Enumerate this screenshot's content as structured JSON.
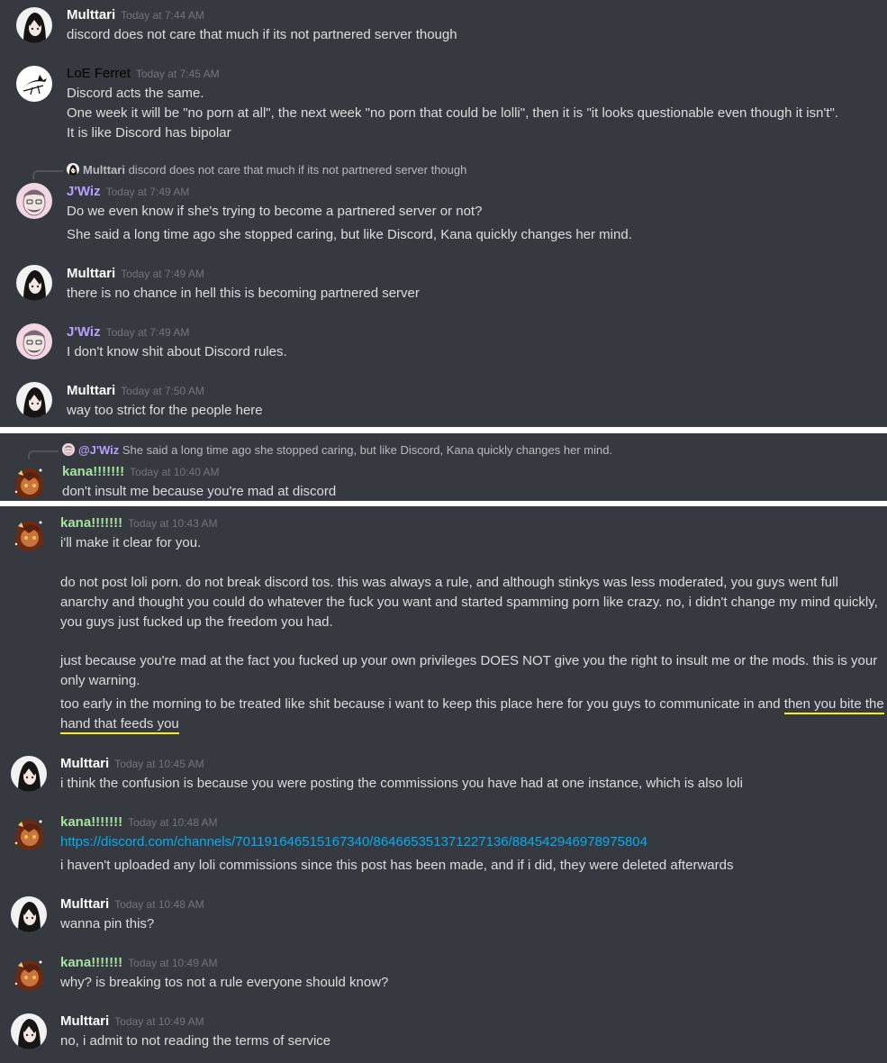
{
  "colors": {
    "background": "#36393f",
    "text": "#dcddde",
    "timestamp": "#72767d",
    "link": "#00aff4",
    "highlight": "#ffee00",
    "multtari": "#ffffff",
    "loe_ferret": "#000000",
    "jwiz": "#b9a0ff",
    "kana": "#a6e3a1"
  },
  "panel1": {
    "messages": [
      {
        "author": "Multtari",
        "timestamp": "Today at 7:44 AM",
        "avatar": "multtari-avatar",
        "lines": [
          "discord does not care that much if its not partnered server though"
        ]
      },
      {
        "author": "LoE Ferret",
        "timestamp": "Today at 7:45 AM",
        "avatar": "ferret-avatar",
        "lines": [
          "Discord acts the same.",
          "One week it will be \"no porn at all\", the next week  \"no porn that could be lolli\", then it is \"it looks questionable even though it isn't\".",
          "It is like Discord has bipolar"
        ]
      },
      {
        "reply": {
          "author": "Multtari",
          "text": "discord does not care that much if its not partnered server though"
        },
        "author": "J'Wiz",
        "timestamp": "Today at 7:49 AM",
        "avatar": "jwiz-avatar",
        "lines": [
          "Do we even know if she's trying to become a partnered server or not?",
          "She said a long time ago she stopped caring, but like Discord, Kana quickly changes her mind."
        ]
      },
      {
        "author": "Multtari",
        "timestamp": "Today at 7:49 AM",
        "avatar": "multtari-avatar",
        "lines": [
          "there is no chance in hell this is becoming partnered server"
        ]
      },
      {
        "author": "J'Wiz",
        "timestamp": "Today at 7:49 AM",
        "avatar": "jwiz-avatar",
        "lines": [
          "I don't know shit about Discord rules."
        ]
      },
      {
        "author": "Multtari",
        "timestamp": "Today at 7:50 AM",
        "avatar": "multtari-avatar",
        "lines": [
          "way too strict for the people here"
        ]
      }
    ]
  },
  "panel2": {
    "messages": [
      {
        "reply": {
          "author": "@J'Wiz",
          "text": "She said a long time ago she stopped caring, but like Discord, Kana quickly changes her mind."
        },
        "author": "kana!!!!!!!",
        "timestamp": "Today at 10:40 AM",
        "avatar": "kana-avatar",
        "lines": [
          "don't insult me because you're mad at discord"
        ]
      }
    ]
  },
  "panel3": {
    "messages": [
      {
        "author": "kana!!!!!!!",
        "timestamp": "Today at 10:43 AM",
        "avatar": "kana-avatar",
        "lines": [
          "i'll make it clear for you.",
          "do not post loli porn. do not break discord tos. this was always a rule, and although stinkys was less moderated, you guys went full anarchy and thought you could do whatever the fuck you want and started spamming porn like crazy. no, i didn't change my mind quickly, you guys just fucked up the freedom you had.",
          "just because you're mad at the fact you fucked up your own privileges DOES NOT give you the right to insult me or the mods. this is your only warning.",
          "too early in the morning to be treated like shit because i want to keep this place here for you guys to communicate in and "
        ],
        "highlighted": "then you bite the hand that feeds you"
      },
      {
        "author": "Multtari",
        "timestamp": "Today at 10:45 AM",
        "avatar": "multtari-avatar",
        "lines": [
          "i think the confusion is because you were posting the commissions you have had at one instance, which is also loli"
        ]
      },
      {
        "author": "kana!!!!!!!",
        "timestamp": "Today at 10:48 AM",
        "avatar": "kana-avatar",
        "link": "https://discord.com/channels/701191646515167340/864665351371227136/884542946978975804",
        "lines": [
          "i haven't uploaded any loli commissions since this post has been made, and if i did, they were deleted afterwards"
        ]
      },
      {
        "author": "Multtari",
        "timestamp": "Today at 10:48 AM",
        "avatar": "multtari-avatar",
        "lines": [
          "wanna pin this?"
        ]
      },
      {
        "author": "kana!!!!!!!",
        "timestamp": "Today at 10:49 AM",
        "avatar": "kana-avatar",
        "lines": [
          "why? is breaking tos not a rule everyone should know?"
        ]
      },
      {
        "author": "Multtari",
        "timestamp": "Today at 10:49 AM",
        "avatar": "multtari-avatar",
        "lines": [
          "no, i admit to not reading the terms of service"
        ]
      }
    ]
  }
}
